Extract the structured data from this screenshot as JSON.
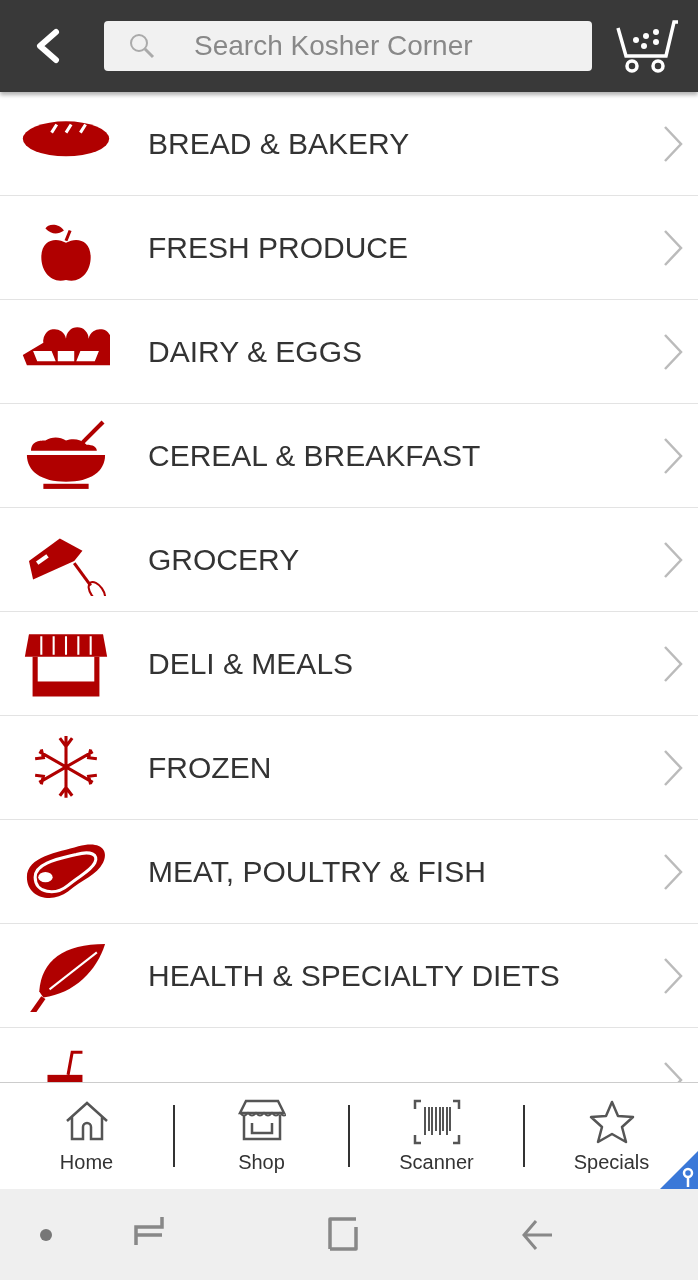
{
  "search": {
    "placeholder": "Search Kosher Corner"
  },
  "categories": [
    {
      "label": "BREAD & BAKERY"
    },
    {
      "label": "FRESH PRODUCE"
    },
    {
      "label": "DAIRY & EGGS"
    },
    {
      "label": "CEREAL & BREAKFAST"
    },
    {
      "label": "GROCERY"
    },
    {
      "label": "DELI & MEALS"
    },
    {
      "label": "FROZEN"
    },
    {
      "label": "MEAT, POULTRY & FISH"
    },
    {
      "label": "HEALTH & SPECIALTY DIETS"
    }
  ],
  "more_below": true,
  "bottom_nav": [
    {
      "label": "Home"
    },
    {
      "label": "Shop"
    },
    {
      "label": "Scanner"
    },
    {
      "label": "Specials"
    }
  ]
}
